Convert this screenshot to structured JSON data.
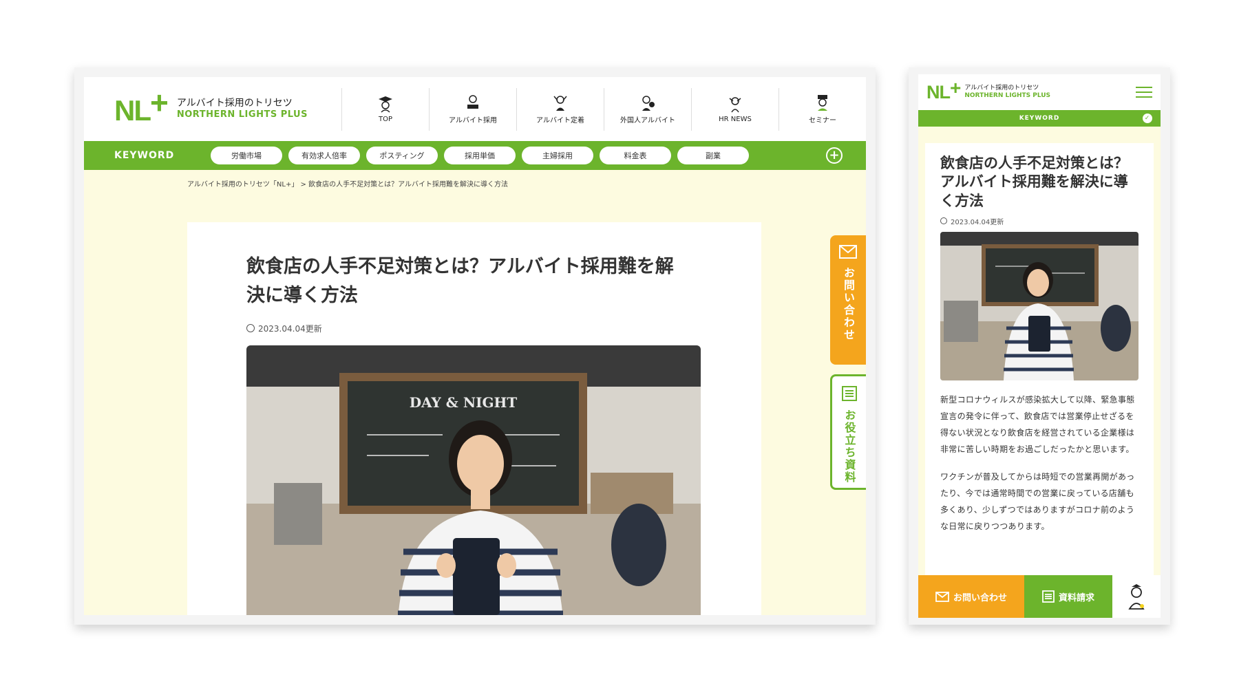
{
  "desktop": {
    "logo": {
      "mark": "NL",
      "plus": "+",
      "tagline": "アルバイト採用のトリセツ",
      "brand": "NORTHERN LIGHTS PLUS"
    },
    "nav": [
      {
        "label": "TOP",
        "icon": "mascot-graduate-icon"
      },
      {
        "label": "アルバイト採用",
        "icon": "mascot-desk-icon"
      },
      {
        "label": "アルバイト定着",
        "icon": "mascot-cheer-icon"
      },
      {
        "label": "外国人アルバイト",
        "icon": "mascot-globe-icon"
      },
      {
        "label": "HR NEWS",
        "icon": "mascot-news-icon"
      },
      {
        "label": "セミナー",
        "icon": "mascot-seminar-icon"
      }
    ],
    "keyword": {
      "label": "KEYWORD",
      "tags": [
        "労働市場",
        "有効求人倍率",
        "ポスティング",
        "採用単価",
        "主婦採用",
        "料金表",
        "副業"
      ],
      "expand": "+"
    },
    "breadcrumb": "アルバイト採用のトリセツ「NL+」 > 飲食店の人手不足対策とは？アルバイト採用難を解決に導く方法",
    "article": {
      "title": "飲食店の人手不足対策とは？アルバイト採用難を解決に導く方法",
      "date": "2023.04.04更新",
      "image_sign": "DAY & NIGHT"
    },
    "side_tabs": {
      "contact": "お問い合わせ",
      "material": "お役立ち資料"
    }
  },
  "mobile": {
    "logo": {
      "mark": "NL",
      "plus": "+",
      "tagline": "アルバイト採用のトリセツ",
      "brand": "NORTHERN LIGHTS PLUS"
    },
    "keyword": "KEYWORD",
    "article": {
      "title": "飲食店の人手不足対策とは？アルバイト採用難を解決に導く方法",
      "date": "2023.04.04更新",
      "p1": "新型コロナウィルスが感染拡大して以降、緊急事態宣言の発令に伴って、飲食店では営業停止せざるを得ない状況となり飲食店を経営されている企業様は非常に苦しい時期をお過ごしだったかと思います。",
      "p2": "ワクチンが普及してからは時短での営業再開があったり、今では通常時間での営業に戻っている店舗も多くあり、少しずつではありますがコロナ前のような日常に戻りつつあります。"
    },
    "bottom_bar": {
      "contact": "お問い合わせ",
      "material": "資料請求"
    }
  },
  "colors": {
    "brand_green": "#6cb42c",
    "accent_orange": "#f4a51d",
    "page_bg": "#fdfbe0"
  }
}
